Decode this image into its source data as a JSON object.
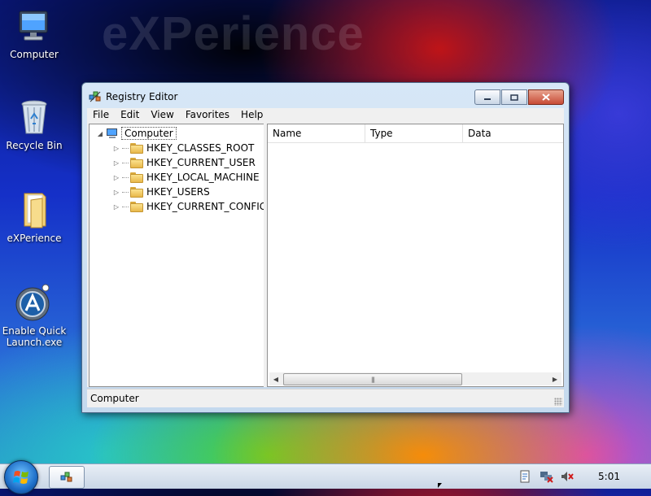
{
  "desktop": {
    "watermark": "eXPerience",
    "icons": [
      {
        "label": "Computer"
      },
      {
        "label": "Recycle Bin"
      },
      {
        "label": "eXPerience"
      },
      {
        "label": "Enable Quick Launch.exe"
      }
    ]
  },
  "window": {
    "title": "Registry Editor",
    "menu": [
      "File",
      "Edit",
      "View",
      "Favorites",
      "Help"
    ],
    "tree": {
      "root": "Computer",
      "children": [
        "HKEY_CLASSES_ROOT",
        "HKEY_CURRENT_USER",
        "HKEY_LOCAL_MACHINE",
        "HKEY_USERS",
        "HKEY_CURRENT_CONFIG"
      ]
    },
    "list": {
      "columns": [
        "Name",
        "Type",
        "Data"
      ]
    },
    "status": "Computer"
  },
  "taskbar": {
    "clock": "5:01"
  }
}
